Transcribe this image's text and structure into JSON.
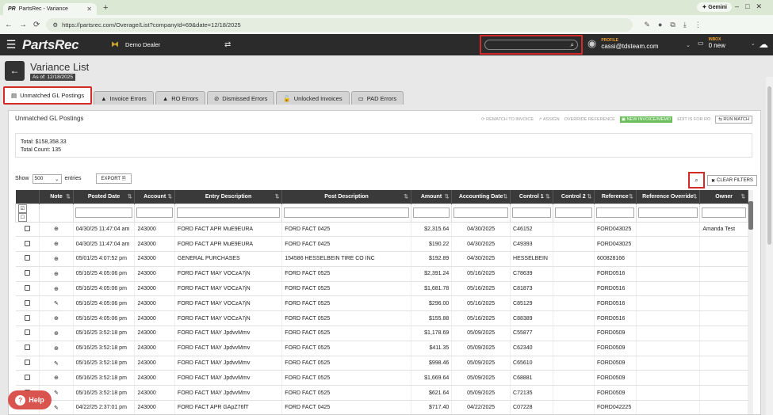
{
  "browser": {
    "tab_title": "PartsRec - Variance",
    "tab_favicon": "PR",
    "url": "https://partsrec.com/Overage/List?companyId=69&date=12/18/2025",
    "gemini_label": "Gemini"
  },
  "app": {
    "logo": "PartsRec",
    "dealer": "Demo Dealer",
    "profile_label": "PROFILE",
    "profile_email": "cassi@tdsteam.com",
    "inbox_label": "INBOX",
    "inbox_count": "0 new"
  },
  "page": {
    "title": "Variance List",
    "as_of": "As of: 12/18/2025"
  },
  "tabs": [
    {
      "label": "Unmatched GL Postings",
      "icon": "list-icon",
      "active": true
    },
    {
      "label": "Invoice Errors",
      "icon": "warning-icon",
      "active": false
    },
    {
      "label": "RO Errors",
      "icon": "warning-icon",
      "active": false
    },
    {
      "label": "Dismissed Errors",
      "icon": "dismissed-icon",
      "active": false
    },
    {
      "label": "Unlocked Invoices",
      "icon": "unlock-icon",
      "active": false
    },
    {
      "label": "PAD Errors",
      "icon": "pad-icon",
      "active": false
    }
  ],
  "panel": {
    "title": "Unmatched GL Postings",
    "actions": {
      "rematch": "REMATCH TO INVOICE",
      "assign": "ASSIGN",
      "override": "OVERRIDE REFERENCE",
      "new_invoice": "NEW INVOICE/MEMO",
      "edit_ro": "EDIT IS FOR RO",
      "run_match": "RUN MATCH"
    },
    "total": "Total: $158,358.33",
    "total_count": "Total Count: 135",
    "show_label": "Show",
    "show_value": "500",
    "entries_label": "entries",
    "export_label": "EXPORT",
    "clear_filters": "CLEAR FILTERS"
  },
  "table": {
    "headers": [
      "Note",
      "Posted Date",
      "Account",
      "Entry Description",
      "Post Description",
      "Amount",
      "Accounting Date",
      "Control 1",
      "Control 2",
      "Reference",
      "Reference Override",
      "Owner"
    ],
    "rows": [
      {
        "note": "plus",
        "posted": "04/30/25 11:47:04 am",
        "account": "243000",
        "entry": "FORD FACT APR MuE9EURA",
        "post": "FORD FACT 0425",
        "amount": "$2,315.64",
        "acct_date": "04/30/2025",
        "c1": "C46152",
        "c2": "",
        "ref": "FORD043025",
        "ref_override": "",
        "owner": "Amanda Test"
      },
      {
        "note": "plus",
        "posted": "04/30/25 11:47:04 am",
        "account": "243000",
        "entry": "FORD FACT APR MuE9EURA",
        "post": "FORD FACT 0425",
        "amount": "$190.22",
        "acct_date": "04/30/2025",
        "c1": "C49393",
        "c2": "",
        "ref": "FORD043025",
        "ref_override": "",
        "owner": ""
      },
      {
        "note": "plus",
        "posted": "05/01/25 4:07:52 pm",
        "account": "243000",
        "entry": "GENERAL PURCHASES",
        "post": "154586 HESSELBEIN TIRE CO INC",
        "amount": "$192.89",
        "acct_date": "04/30/2025",
        "c1": "HESSELBEIN",
        "c2": "",
        "ref": "600828166",
        "ref_override": "",
        "owner": ""
      },
      {
        "note": "plus",
        "posted": "05/16/25 4:05:06 pm",
        "account": "243000",
        "entry": "FORD FACT MAY VOCzA7jN",
        "post": "FORD FACT 0525",
        "amount": "$2,391.24",
        "acct_date": "05/16/2025",
        "c1": "C78639",
        "c2": "",
        "ref": "FORD0516",
        "ref_override": "",
        "owner": ""
      },
      {
        "note": "plus",
        "posted": "05/16/25 4:05:06 pm",
        "account": "243000",
        "entry": "FORD FACT MAY VOCzA7jN",
        "post": "FORD FACT 0525",
        "amount": "$1,681.78",
        "acct_date": "05/16/2025",
        "c1": "C81873",
        "c2": "",
        "ref": "FORD0516",
        "ref_override": "",
        "owner": ""
      },
      {
        "note": "edit",
        "posted": "05/16/25 4:05:06 pm",
        "account": "243000",
        "entry": "FORD FACT MAY VOCzA7jN",
        "post": "FORD FACT 0525",
        "amount": "$296.00",
        "acct_date": "05/16/2025",
        "c1": "C85129",
        "c2": "",
        "ref": "FORD0516",
        "ref_override": "",
        "owner": ""
      },
      {
        "note": "plus",
        "posted": "05/16/25 4:05:06 pm",
        "account": "243000",
        "entry": "FORD FACT MAY VOCzA7jN",
        "post": "FORD FACT 0525",
        "amount": "$155.88",
        "acct_date": "05/16/2025",
        "c1": "C88389",
        "c2": "",
        "ref": "FORD0516",
        "ref_override": "",
        "owner": ""
      },
      {
        "note": "plus",
        "posted": "05/16/25 3:52:18 pm",
        "account": "243000",
        "entry": "FORD FACT MAY JpdvvMmv",
        "post": "FORD FACT 0525",
        "amount": "$1,178.69",
        "acct_date": "05/09/2025",
        "c1": "C55877",
        "c2": "",
        "ref": "FORD0509",
        "ref_override": "",
        "owner": ""
      },
      {
        "note": "plus",
        "posted": "05/16/25 3:52:18 pm",
        "account": "243000",
        "entry": "FORD FACT MAY JpdvvMmv",
        "post": "FORD FACT 0525",
        "amount": "$411.35",
        "acct_date": "05/09/2025",
        "c1": "C62340",
        "c2": "",
        "ref": "FORD0509",
        "ref_override": "",
        "owner": ""
      },
      {
        "note": "edit",
        "posted": "05/16/25 3:52:18 pm",
        "account": "243000",
        "entry": "FORD FACT MAY JpdvvMmv",
        "post": "FORD FACT 0525",
        "amount": "$998.46",
        "acct_date": "05/09/2025",
        "c1": "C65610",
        "c2": "",
        "ref": "FORD0509",
        "ref_override": "",
        "owner": ""
      },
      {
        "note": "plus",
        "posted": "05/16/25 3:52:18 pm",
        "account": "243000",
        "entry": "FORD FACT MAY JpdvvMmv",
        "post": "FORD FACT 0525",
        "amount": "$1,669.64",
        "acct_date": "05/09/2025",
        "c1": "C68881",
        "c2": "",
        "ref": "FORD0509",
        "ref_override": "",
        "owner": ""
      },
      {
        "note": "edit",
        "posted": "05/16/25 3:52:18 pm",
        "account": "243000",
        "entry": "FORD FACT MAY JpdvvMmv",
        "post": "FORD FACT 0525",
        "amount": "$621.64",
        "acct_date": "05/09/2025",
        "c1": "C72135",
        "c2": "",
        "ref": "FORD0509",
        "ref_override": "",
        "owner": ""
      },
      {
        "note": "edit",
        "posted": "04/22/25 2:37:01 pm",
        "account": "243000",
        "entry": "FORD FACT APR GApZ76fT",
        "post": "FORD FACT 0425",
        "amount": "$717.40",
        "acct_date": "04/22/2025",
        "c1": "C07228",
        "c2": "",
        "ref": "FORD042225",
        "ref_override": "",
        "owner": ""
      }
    ]
  },
  "help_label": "Help",
  "colors": {
    "highlight": "#d42a2a",
    "nav_bg": "#2b2b2b",
    "green": "#6abf5a",
    "help": "#d9534f"
  }
}
